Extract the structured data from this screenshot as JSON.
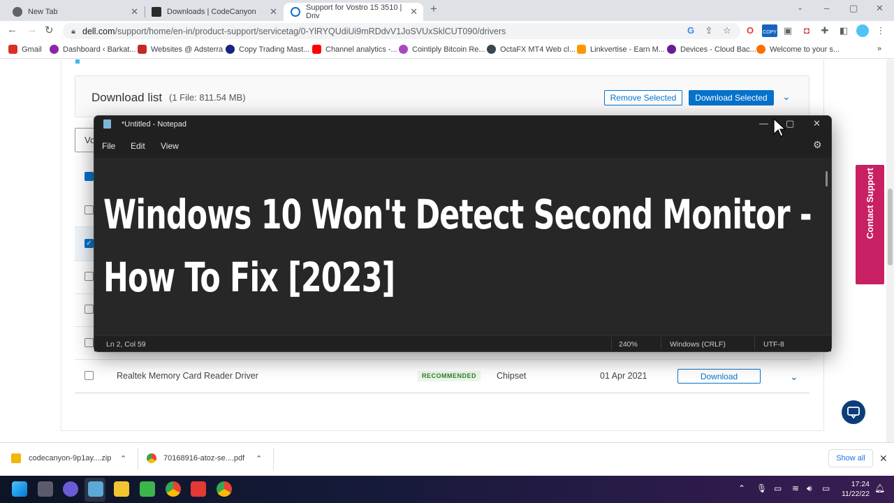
{
  "browser": {
    "tabs": [
      {
        "label": "New Tab",
        "fav_color": "#5f6368"
      },
      {
        "label": "Downloads | CodeCanyon",
        "fav_color": "#2b2b2b"
      },
      {
        "label": "Support for Vostro 15 3510 | Driv",
        "fav_color": "#0672cb"
      }
    ],
    "url_host": "dell.com",
    "url_path": "/support/home/en-in/product-support/servicetag/0-YlRYQUdiUi9mRDdvV1JoSVUxSklCUT090/drivers",
    "bookmarks": [
      {
        "label": "Gmail",
        "color": "#d93025"
      },
      {
        "label": "Dashboard ‹ Barkat...",
        "color": "#8e24aa"
      },
      {
        "label": "Websites @ Adsterra",
        "color": "#c62828"
      },
      {
        "label": "Copy Trading Mast...",
        "color": "#1a237e"
      },
      {
        "label": "Channel analytics -...",
        "color": "#ff0000"
      },
      {
        "label": "Cointiply Bitcoin Re...",
        "color": "#ab47bc"
      },
      {
        "label": "OctaFX MT4 Web cl...",
        "color": "#37474f"
      },
      {
        "label": "Linkvertise - Earn M...",
        "color": "#ff9800"
      },
      {
        "label": "Devices - Cloud Bac...",
        "color": "#6a1b9a"
      },
      {
        "label": "Welcome to your s...",
        "color": "#ff6f00"
      }
    ],
    "more": "»"
  },
  "page": {
    "download_list_title": "Download list",
    "download_list_info": "(1 File: 811.54 MB)",
    "remove_selected": "Remove Selected",
    "download_selected": "Download Selected",
    "select_partial": "Vo",
    "row": {
      "name": "Realtek Memory Card Reader Driver",
      "badge": "RECOMMENDED",
      "category": "Chipset",
      "date": "01 Apr 2021",
      "action": "Download"
    },
    "contact_support": "Contact Support"
  },
  "notepad": {
    "title": "*Untitled - Notepad",
    "menu": [
      "File",
      "Edit",
      "View"
    ],
    "text": "Windows 10 Won't Detect Second Monitor -\nHow To Fix [2023]",
    "status": {
      "position": "Ln 2, Col 59",
      "zoom": "240%",
      "line_ending": "Windows (CRLF)",
      "encoding": "UTF-8"
    }
  },
  "downloads_bar": {
    "items": [
      "codecanyon-9p1ay....zip",
      "70168916-atoz-se....pdf"
    ],
    "show_all": "Show all"
  },
  "taskbar": {
    "time": "17:24",
    "date": "11/22/22"
  }
}
